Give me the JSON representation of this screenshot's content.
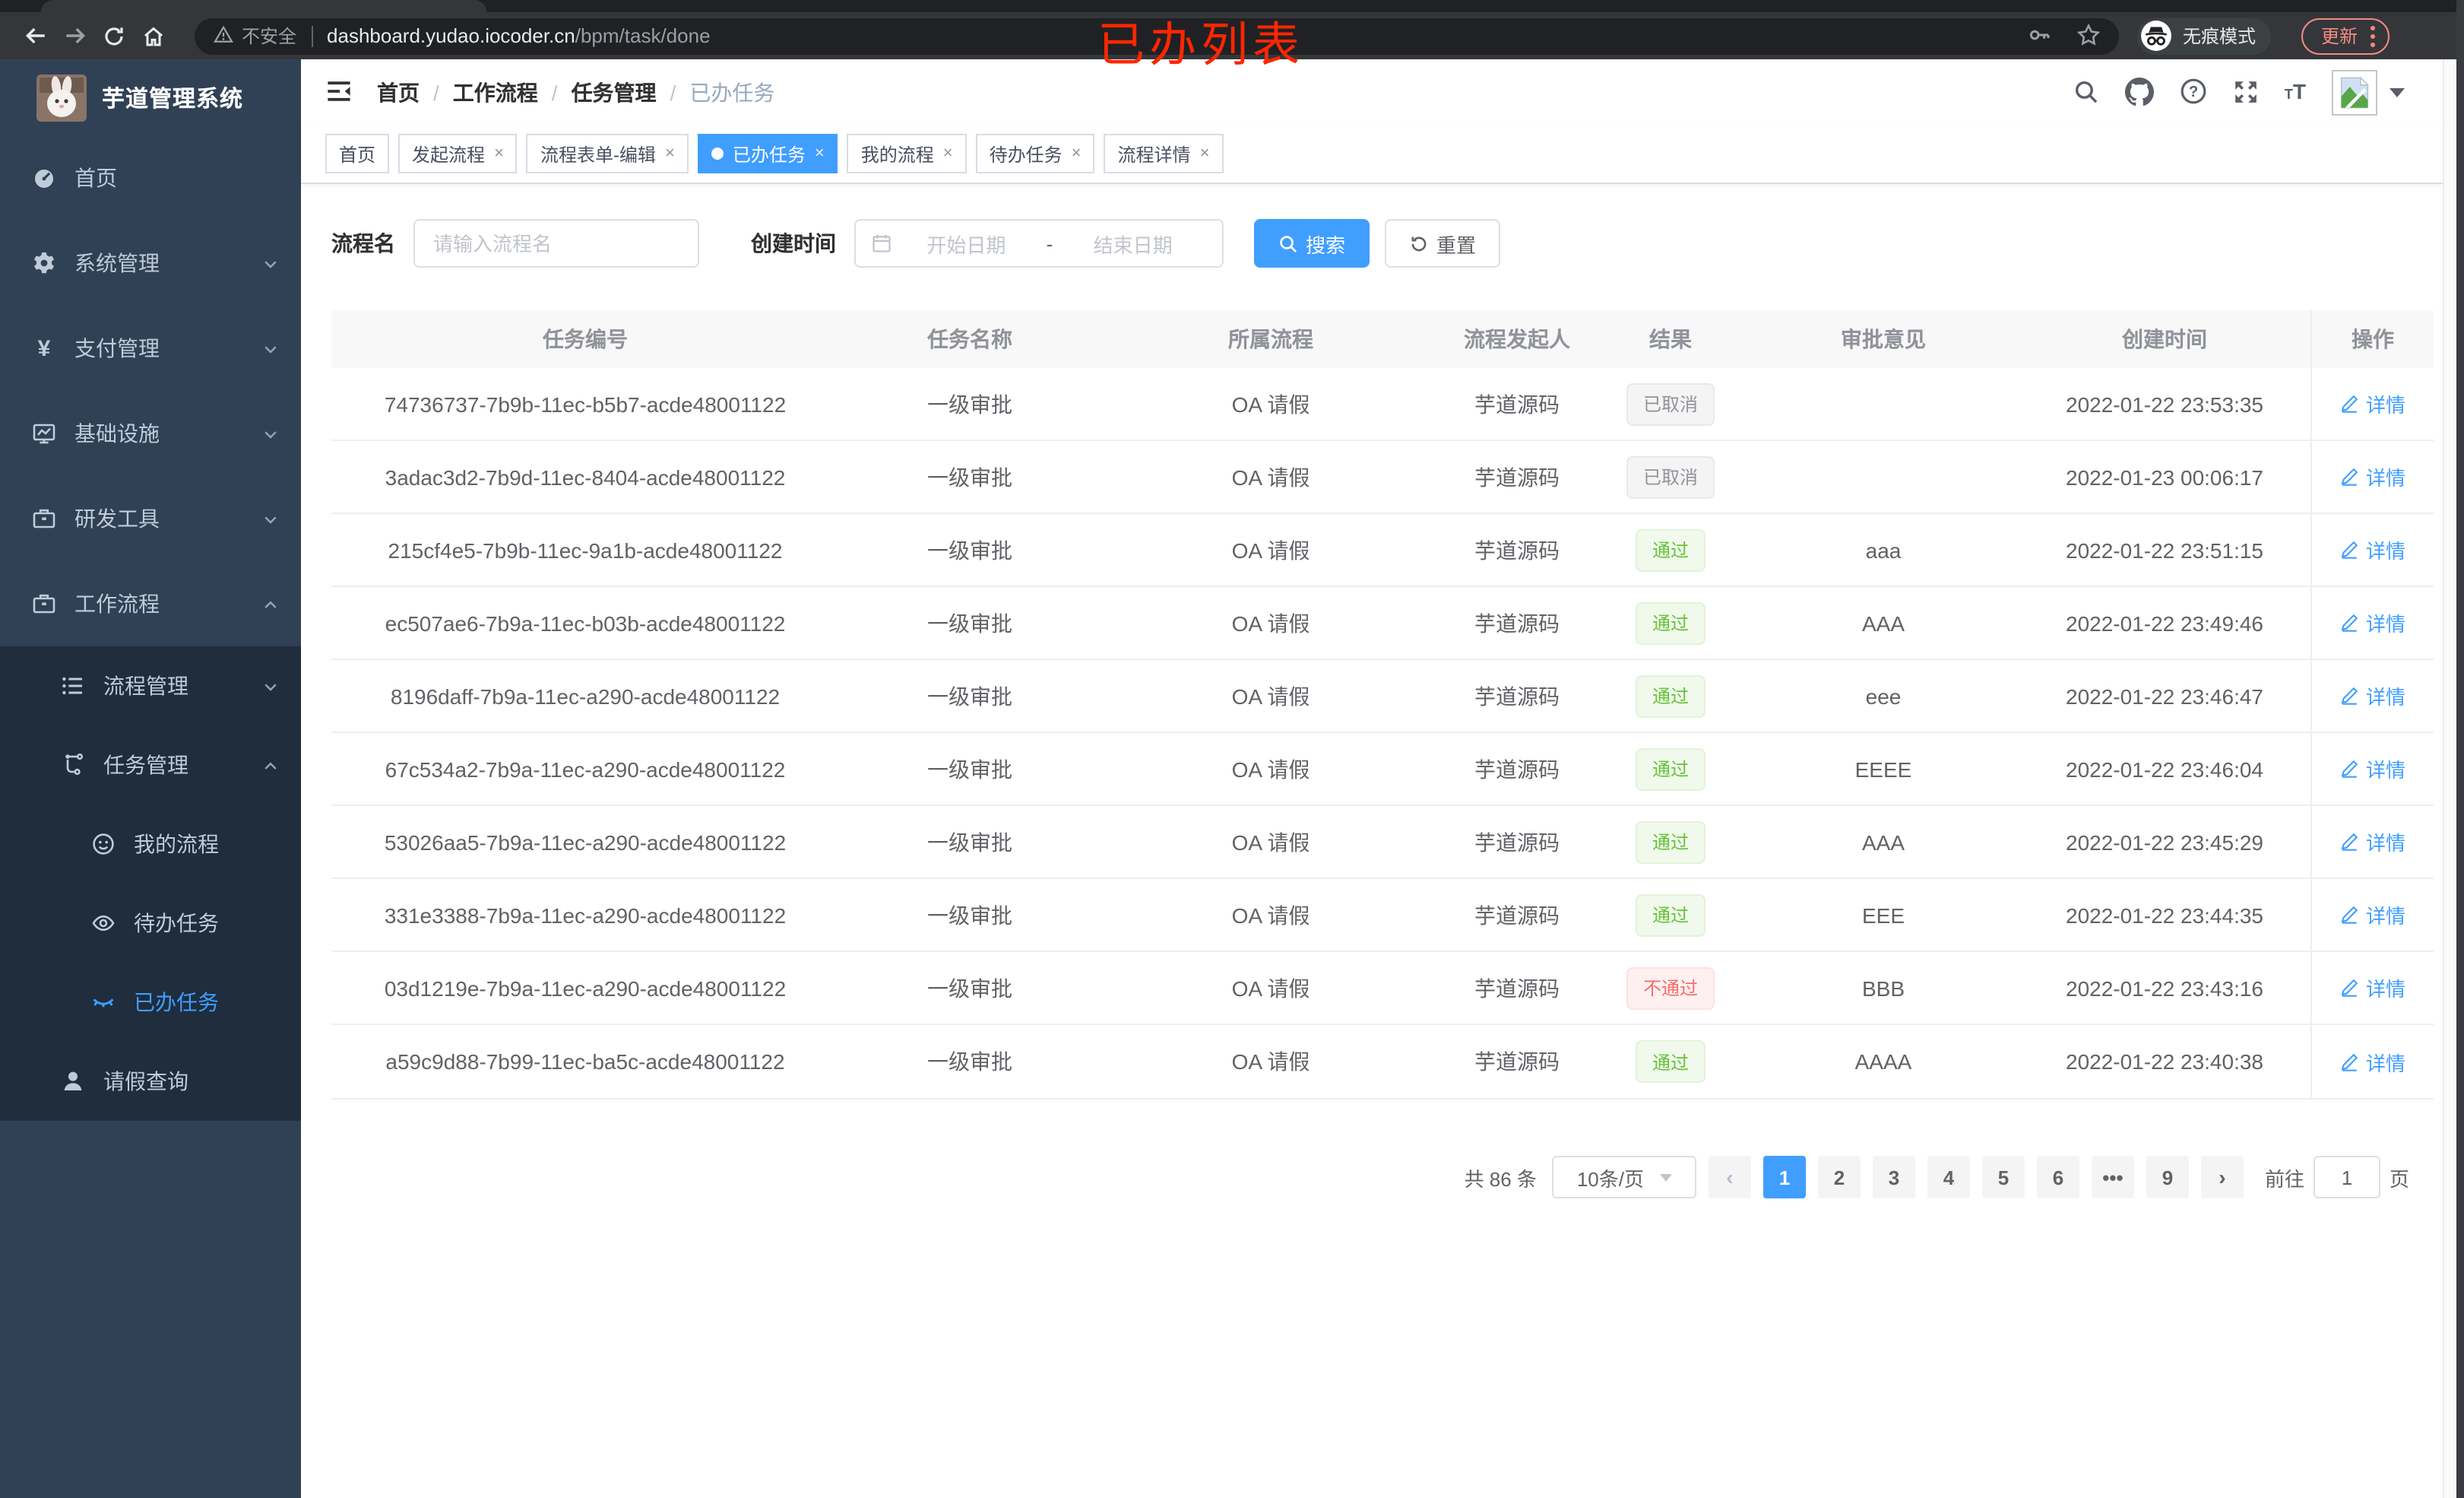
{
  "colors": {
    "accent": "#409eff",
    "success": "#67c23a",
    "danger": "#f56c6c",
    "info": "#909399",
    "annotation": "#ff2600",
    "sidebar_bg": "#304156",
    "submenu_bg": "#1f2d3d"
  },
  "annotation": {
    "title": "已办列表"
  },
  "browser": {
    "security_label": "不安全",
    "url_host": "dashboard.yudao.iocoder.cn",
    "url_path": "/bpm/task/done",
    "incognito_label": "无痕模式",
    "update_label": "更新"
  },
  "sidebar": {
    "app_title": "芋道管理系统",
    "menu": [
      {
        "label": "首页",
        "icon": "gauge-icon",
        "level": 1
      },
      {
        "label": "系统管理",
        "icon": "gear-icon",
        "level": 1,
        "chevron": "down"
      },
      {
        "label": "支付管理",
        "icon": "yen-icon",
        "level": 1,
        "chevron": "down"
      },
      {
        "label": "基础设施",
        "icon": "monitor-icon",
        "level": 1,
        "chevron": "down"
      },
      {
        "label": "研发工具",
        "icon": "briefcase-icon",
        "level": 1,
        "chevron": "down"
      },
      {
        "label": "工作流程",
        "icon": "briefcase-icon",
        "level": 1,
        "chevron": "up"
      },
      {
        "label": "流程管理",
        "icon": "list-icon",
        "level": 2,
        "chevron": "down",
        "sub": true
      },
      {
        "label": "任务管理",
        "icon": "flow-icon",
        "level": 2,
        "chevron": "up",
        "sub": true
      },
      {
        "label": "我的流程",
        "icon": "user-smile-icon",
        "level": 3,
        "sub": true
      },
      {
        "label": "待办任务",
        "icon": "eye-open-icon",
        "level": 3,
        "sub": true
      },
      {
        "label": "已办任务",
        "icon": "eye-closed-icon",
        "level": 3,
        "sub": true,
        "active": true
      },
      {
        "label": "请假查询",
        "icon": "user-icon",
        "level": 2,
        "sub": true
      }
    ]
  },
  "header": {
    "breadcrumb": [
      "首页",
      "工作流程",
      "任务管理",
      "已办任务"
    ]
  },
  "tabs": [
    {
      "label": "首页",
      "closable": false,
      "active": false
    },
    {
      "label": "发起流程",
      "closable": true,
      "active": false
    },
    {
      "label": "流程表单-编辑",
      "closable": true,
      "active": false
    },
    {
      "label": "已办任务",
      "closable": true,
      "active": true
    },
    {
      "label": "我的流程",
      "closable": true,
      "active": false
    },
    {
      "label": "待办任务",
      "closable": true,
      "active": false
    },
    {
      "label": "流程详情",
      "closable": true,
      "active": false
    }
  ],
  "filters": {
    "name_label": "流程名",
    "name_placeholder": "请输入流程名",
    "time_label": "创建时间",
    "date_start_placeholder": "开始日期",
    "date_separator": "-",
    "date_end_placeholder": "结束日期",
    "search_label": "搜索",
    "reset_label": "重置"
  },
  "table": {
    "columns": [
      "任务编号",
      "任务名称",
      "所属流程",
      "流程发起人",
      "结果",
      "审批意见",
      "创建时间",
      "操作"
    ],
    "action_label": "详情",
    "rows": [
      {
        "id": "74736737-7b9b-11ec-b5b7-acde48001122",
        "task": "一级审批",
        "process": "OA 请假",
        "starter": "芋道源码",
        "result": "已取消",
        "result_type": "info",
        "comment": "",
        "created": "2022-01-22 23:53:35"
      },
      {
        "id": "3adac3d2-7b9d-11ec-8404-acde48001122",
        "task": "一级审批",
        "process": "OA 请假",
        "starter": "芋道源码",
        "result": "已取消",
        "result_type": "info",
        "comment": "",
        "created": "2022-01-23 00:06:17"
      },
      {
        "id": "215cf4e5-7b9b-11ec-9a1b-acde48001122",
        "task": "一级审批",
        "process": "OA 请假",
        "starter": "芋道源码",
        "result": "通过",
        "result_type": "success",
        "comment": "aaa",
        "created": "2022-01-22 23:51:15"
      },
      {
        "id": "ec507ae6-7b9a-11ec-b03b-acde48001122",
        "task": "一级审批",
        "process": "OA 请假",
        "starter": "芋道源码",
        "result": "通过",
        "result_type": "success",
        "comment": "AAA",
        "created": "2022-01-22 23:49:46"
      },
      {
        "id": "8196daff-7b9a-11ec-a290-acde48001122",
        "task": "一级审批",
        "process": "OA 请假",
        "starter": "芋道源码",
        "result": "通过",
        "result_type": "success",
        "comment": "eee",
        "created": "2022-01-22 23:46:47"
      },
      {
        "id": "67c534a2-7b9a-11ec-a290-acde48001122",
        "task": "一级审批",
        "process": "OA 请假",
        "starter": "芋道源码",
        "result": "通过",
        "result_type": "success",
        "comment": "EEEE",
        "created": "2022-01-22 23:46:04"
      },
      {
        "id": "53026aa5-7b9a-11ec-a290-acde48001122",
        "task": "一级审批",
        "process": "OA 请假",
        "starter": "芋道源码",
        "result": "通过",
        "result_type": "success",
        "comment": "AAA",
        "created": "2022-01-22 23:45:29"
      },
      {
        "id": "331e3388-7b9a-11ec-a290-acde48001122",
        "task": "一级审批",
        "process": "OA 请假",
        "starter": "芋道源码",
        "result": "通过",
        "result_type": "success",
        "comment": "EEE",
        "created": "2022-01-22 23:44:35"
      },
      {
        "id": "03d1219e-7b9a-11ec-a290-acde48001122",
        "task": "一级审批",
        "process": "OA 请假",
        "starter": "芋道源码",
        "result": "不通过",
        "result_type": "danger",
        "comment": "BBB",
        "created": "2022-01-22 23:43:16"
      },
      {
        "id": "a59c9d88-7b99-11ec-ba5c-acde48001122",
        "task": "一级审批",
        "process": "OA 请假",
        "starter": "芋道源码",
        "result": "通过",
        "result_type": "success",
        "comment": "AAAA",
        "created": "2022-01-22 23:40:38"
      }
    ]
  },
  "pagination": {
    "total_label": "共 86 条",
    "page_size_label": "10条/页",
    "pages": [
      "1",
      "2",
      "3",
      "4",
      "5",
      "6",
      "•••",
      "9"
    ],
    "active_page": "1",
    "goto_label": "前往",
    "goto_value": "1",
    "goto_unit": "页"
  }
}
